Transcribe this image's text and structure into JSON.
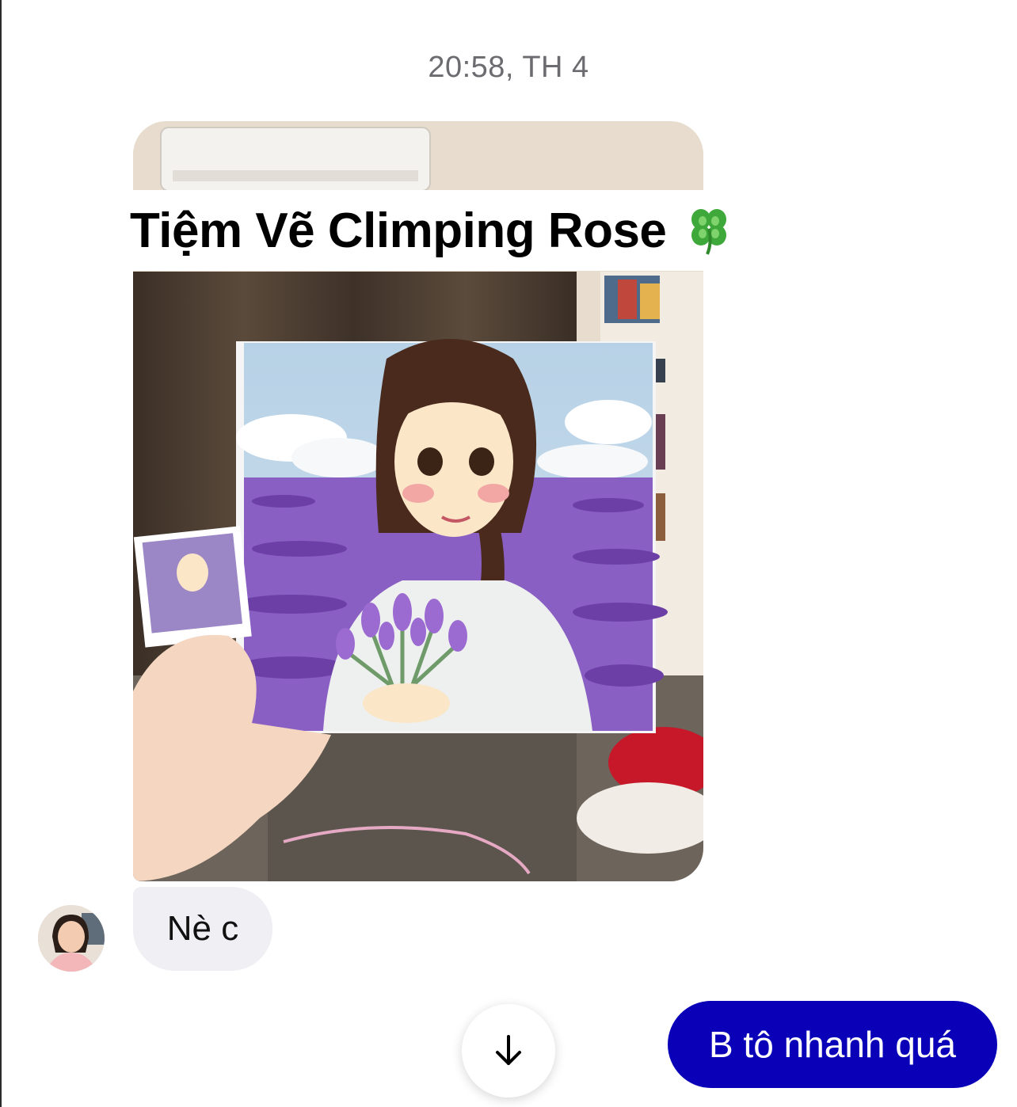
{
  "conversation": {
    "timestamp": "20:58, TH 4",
    "photo_overlay_text": "Tiệm Vẽ Climping Rose",
    "overlay_emoji": "four-leaf-clover-icon",
    "incoming_message": "Nè c",
    "outgoing_message": "B tô nhanh quá",
    "scroll_button_icon": "arrow-down-icon"
  },
  "colors": {
    "outgoing_bubble": "#0900b8",
    "incoming_bubble": "#efeff4",
    "timestamp_text": "#6b6b70"
  }
}
